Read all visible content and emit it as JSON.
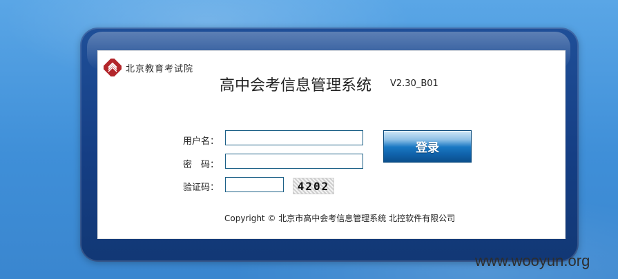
{
  "brand": {
    "name": "北京教育考试院",
    "logo_icon": "institute-logo-icon"
  },
  "app": {
    "title": "高中会考信息管理系统",
    "version": "V2.30_B01"
  },
  "form": {
    "username": {
      "label": "用户名：",
      "value": "",
      "placeholder": ""
    },
    "password": {
      "label": "密　码：",
      "value": "",
      "placeholder": ""
    },
    "captcha": {
      "label": "验证码：",
      "value": "",
      "placeholder": "",
      "image_text": "4202"
    }
  },
  "actions": {
    "login_label": "登录"
  },
  "footer": {
    "copyright": "Copyright © 北京市高中会考信息管理系统 北控软件有限公司"
  },
  "watermark": "www.wooyun.org",
  "colors": {
    "background": "#4a9ae0",
    "frame": "#1a4a92",
    "button": "#1470bc",
    "field_border": "#1b5f86"
  }
}
